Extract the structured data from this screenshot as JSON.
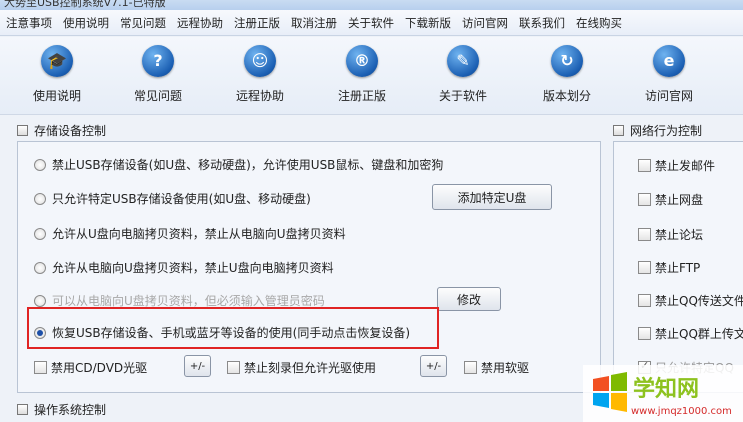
{
  "window": {
    "title": "大势至USB控制系统V7.1-已特版"
  },
  "menu": [
    "注意事项",
    "使用说明",
    "常见问题",
    "远程协助",
    "注册正版",
    "取消注册",
    "关于软件",
    "下载新版",
    "访问官网",
    "联系我们",
    "在线购买"
  ],
  "toolbar": [
    {
      "label": "使用说明",
      "icon": "graduation-cap-icon",
      "glyph": "🎓"
    },
    {
      "label": "常见问题",
      "icon": "question-icon",
      "glyph": "?"
    },
    {
      "label": "远程协助",
      "icon": "remote-assist-icon",
      "glyph": "☺"
    },
    {
      "label": "注册正版",
      "icon": "registered-icon",
      "glyph": "®"
    },
    {
      "label": "关于软件",
      "icon": "pencil-icon",
      "glyph": "✎"
    },
    {
      "label": "版本划分",
      "icon": "refresh-icon",
      "glyph": "↻"
    },
    {
      "label": "访问官网",
      "icon": "browser-icon",
      "glyph": "e"
    }
  ],
  "storage": {
    "title": "存储设备控制",
    "options": [
      {
        "label": "禁止USB存储设备(如U盘、移动硬盘)，允许使用USB鼠标、键盘和加密狗",
        "checked": false,
        "disabled": false
      },
      {
        "label": "只允许特定USB存储设备使用(如U盘、移动硬盘)",
        "checked": false,
        "disabled": false
      },
      {
        "label": "允许从U盘向电脑拷贝资料，禁止从电脑向U盘拷贝资料",
        "checked": false,
        "disabled": false
      },
      {
        "label": "允许从电脑向U盘拷贝资料，禁止U盘向电脑拷贝资料",
        "checked": false,
        "disabled": false
      },
      {
        "label": "可以从电脑向U盘拷贝资料，但必须输入管理员密码",
        "checked": false,
        "disabled": true
      },
      {
        "label": "恢复USB存储设备、手机或蓝牙等设备的使用(同手动点击恢复设备)",
        "checked": true,
        "disabled": false
      }
    ],
    "add_device_button": "添加特定U盘",
    "modify_button": "修改",
    "cd_dvd_label": "禁用CD/DVD光驱",
    "burn_label": "禁止刻录但允许光驱使用",
    "floppy_label": "禁用软驱",
    "toggle_label": "+/-"
  },
  "os_control": {
    "title": "操作系统控制"
  },
  "network": {
    "title": "网络行为控制",
    "items": [
      {
        "label": "禁止发邮件",
        "checked": false,
        "disabled": false
      },
      {
        "label": "禁止网盘",
        "checked": false,
        "disabled": false
      },
      {
        "label": "禁止论坛",
        "checked": false,
        "disabled": false
      },
      {
        "label": "禁止FTP",
        "checked": false,
        "disabled": false
      },
      {
        "label": "禁止QQ传送文件",
        "checked": false,
        "disabled": false
      },
      {
        "label": "禁止QQ群上传文件",
        "checked": false,
        "disabled": false
      },
      {
        "label": "只允许特定QQ",
        "checked": true,
        "disabled": true
      }
    ]
  },
  "watermark": {
    "text": "学知网",
    "url": "www.jmqz1000.com"
  },
  "colors": {
    "highlight": "#e02424",
    "icon_blue": "#1b5fb3",
    "watermark_green": "#8dc21f"
  }
}
